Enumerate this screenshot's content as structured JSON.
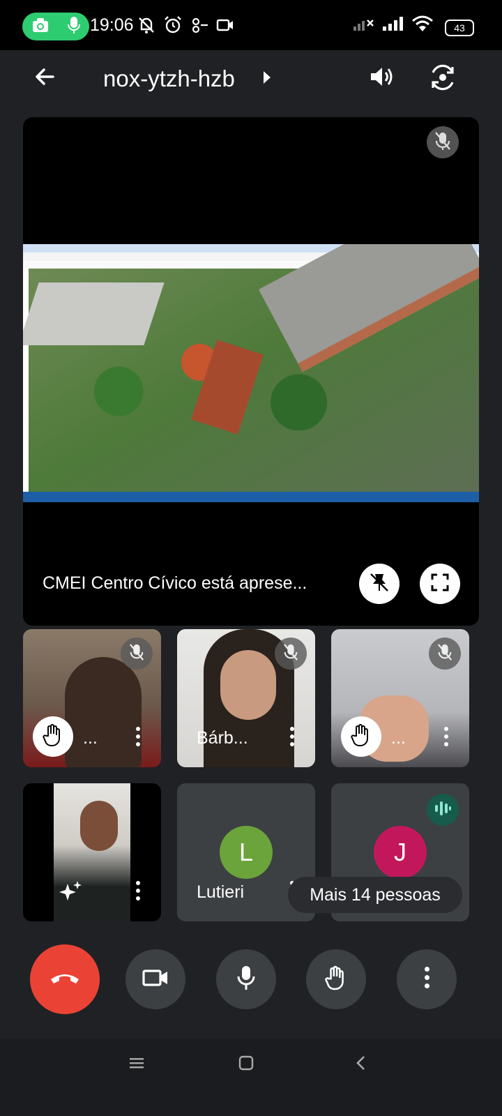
{
  "status_bar": {
    "time": "19:06",
    "battery": "43",
    "icons": [
      "camera-recording-icon",
      "mic-recording-icon",
      "bell-off-icon",
      "alarm-icon",
      "data-saver-icon",
      "video-camera-icon",
      "signal-off-icon",
      "signal-icon",
      "wifi-icon",
      "battery-icon"
    ]
  },
  "header": {
    "meeting_code": "nox-ytzh-hzb",
    "icons": [
      "back-arrow-icon",
      "chevron-right-icon",
      "speaker-icon",
      "switch-camera-icon"
    ]
  },
  "presentation": {
    "label": "CMEI Centro Cívico está aprese...",
    "icons": [
      "mic-off-icon",
      "unpin-icon",
      "fullscreen-icon"
    ]
  },
  "participants": [
    {
      "name": "...",
      "hand_raised": true,
      "muted": true
    },
    {
      "name": "Bárb...",
      "hand_raised": false,
      "muted": true
    },
    {
      "name": "...",
      "hand_raised": true,
      "muted": true
    },
    {
      "name": "",
      "self_view": true
    },
    {
      "name": "Lutieri",
      "initial": "L",
      "avatar_color": "#6aa43a"
    },
    {
      "name": "",
      "initial": "J",
      "avatar_color": "#c2185b",
      "speaking": true
    }
  ],
  "more_people": "Mais 14 pessoas",
  "controls": [
    "end-call-icon",
    "camera-icon",
    "microphone-icon",
    "raise-hand-icon",
    "more-options-icon"
  ],
  "colors": {
    "background": "#202124",
    "end_call": "#ea4335",
    "control_bg": "#3c4043",
    "recording": "#2ecc71"
  }
}
